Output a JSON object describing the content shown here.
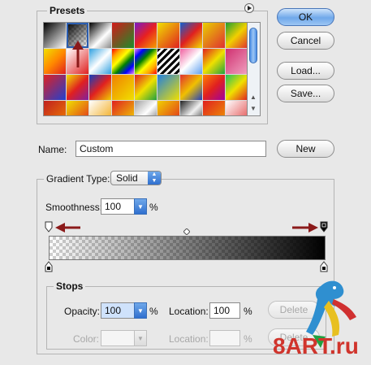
{
  "presets": {
    "label": "Presets",
    "swatches": [
      "linear-gradient(135deg,#000,#fff)",
      "linear-gradient(135deg,#000 0%,rgba(0,0,0,0) 100%), repeating-conic-gradient(#ccc 0% 25%,#fff 0% 50%) 0 0/6px 6px",
      "linear-gradient(135deg,#000,#fff 60%,#888)",
      "linear-gradient(135deg,#d21a1a,#1a8e2a)",
      "linear-gradient(135deg,#7a1ac8,#e82020,#f5a000)",
      "linear-gradient(135deg,#f0e000,#e02020)",
      "linear-gradient(135deg,#1060d0,#e02020,#f0e000)",
      "linear-gradient(135deg,#e8d000,#e03030)",
      "linear-gradient(135deg,#20a030,#f0d000,#e03030)",
      "linear-gradient(135deg,#f0e000,#ff8800,#e02020)",
      "linear-gradient(135deg,#ffffff,#e02020)",
      "linear-gradient(135deg,#30a0e0,#ffffff 50%,#30a0e0)",
      "linear-gradient(135deg,red,orange,yellow,green,blue,violet)",
      "linear-gradient(135deg,violet,blue,green,yellow,orange,red)",
      "repeating-linear-gradient(135deg,#000 0px,#000 3px,#fff 3px,#fff 6px)",
      "linear-gradient(135deg,#f060a0,#ffffff,#60a0f0)",
      "linear-gradient(135deg,#e02020,#f0e000,#20a040)",
      "linear-gradient(135deg,#d03070,#f0a0c0)",
      "linear-gradient(135deg,#e02020,#2040d0)",
      "linear-gradient(135deg,#f0e000,#e02020,#8020a0)",
      "linear-gradient(135deg,#1040c0,#e02020,#f0d000)",
      "linear-gradient(135deg,#f08000,#f0e000)",
      "linear-gradient(135deg,#e02020,#f0e000,#20a040)",
      "linear-gradient(135deg,#2080e0,#f0e000)",
      "linear-gradient(135deg,#e03030,#f0c000,#2040c0)",
      "linear-gradient(135deg,#ff8000,#e02020,#a000a0)",
      "linear-gradient(135deg,#20c060,#f0e000,#e02020)",
      "linear-gradient(135deg,#c02020,#f08000)",
      "linear-gradient(135deg,#f0e000,#e02020)",
      "linear-gradient(135deg,#ffffff,#f0a000)",
      "linear-gradient(135deg,#e02020,#f0e000)",
      "linear-gradient(135deg,#a0a0a0,#ffffff,#606060)",
      "linear-gradient(135deg,#f0d000,#e02020)",
      "linear-gradient(135deg,#202020,#f0f0f0,#202020)",
      "linear-gradient(135deg,#e02020,#f0a000)",
      "linear-gradient(135deg,#ffffff,#e04040)"
    ]
  },
  "buttons": {
    "ok": "OK",
    "cancel": "Cancel",
    "load": "Load...",
    "save": "Save...",
    "new": "New",
    "delete_opacity": "Delete",
    "delete_color": "Delete"
  },
  "name": {
    "label": "Name:",
    "value": "Custom"
  },
  "gradient": {
    "type_label": "Gradient Type:",
    "type_value": "Solid",
    "smoothness_label": "Smoothness:",
    "smoothness_value": "100",
    "smoothness_unit": "%"
  },
  "stops": {
    "label": "Stops",
    "opacity_label": "Opacity:",
    "opacity_value": "100",
    "opacity_unit": "%",
    "location1_label": "Location:",
    "location1_value": "100",
    "location1_unit": "%",
    "color_label": "Color:",
    "location2_label": "Location:",
    "location2_value": "",
    "location2_unit": "%"
  },
  "watermark": "8ART.ru",
  "colors": {
    "accent": "#2f6fcf",
    "arrow": "#8b1a1a",
    "watermark": "#d0342c"
  },
  "icons": {
    "presets_menu": "circle-arrow-right-icon",
    "annotation": "red-arrow-icon"
  }
}
